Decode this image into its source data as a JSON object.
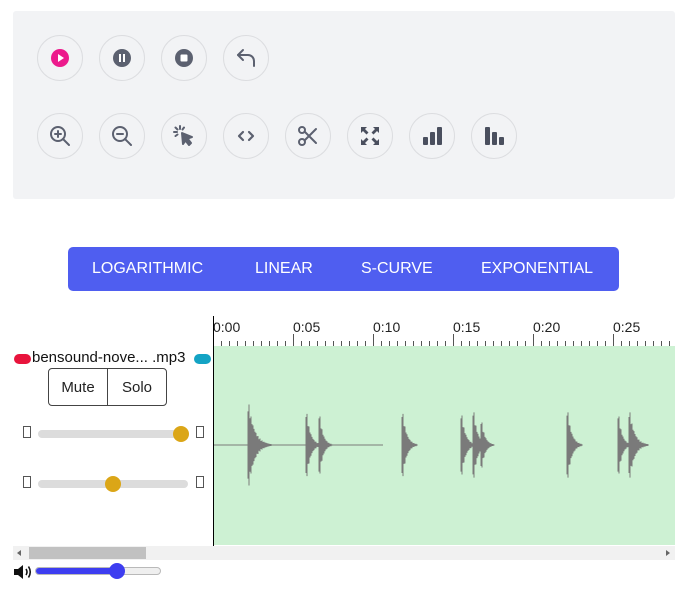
{
  "toolbar": {
    "row1": [
      {
        "name": "play-icon"
      },
      {
        "name": "pause-icon"
      },
      {
        "name": "stop-icon"
      },
      {
        "name": "undo-icon"
      }
    ],
    "row2": [
      {
        "name": "zoom-in-icon"
      },
      {
        "name": "zoom-out-icon"
      },
      {
        "name": "cursor-select-icon"
      },
      {
        "name": "shift-icon"
      },
      {
        "name": "trim-scissors-icon"
      },
      {
        "name": "fit-icon"
      },
      {
        "name": "bars-icon"
      },
      {
        "name": "bars-reverse-icon"
      }
    ]
  },
  "fades": {
    "options": [
      "LOGARITHMIC",
      "LINEAR",
      "S-CURVE",
      "EXPONENTIAL"
    ]
  },
  "timeline": {
    "labels": [
      "0:00",
      "0:05",
      "0:10",
      "0:15",
      "0:20",
      "0:25"
    ]
  },
  "track": {
    "name": "bensound-nove... .mp3",
    "mute_label": "Mute",
    "solo_label": "Solo",
    "gain_level": 0.95,
    "pan_level": 0.5,
    "colors": {
      "left_pill": "#e8143c",
      "right_pill": "#14a3c4",
      "waveform_bg": "#cdf1d3",
      "waveform": "#7a7a7a"
    }
  },
  "master": {
    "volume_icon": "speaker-icon",
    "volume_level": 0.65
  },
  "colors": {
    "accent": "#4f5ef0",
    "play": "#ec1a8c",
    "slider_thumb": "#dba617"
  }
}
